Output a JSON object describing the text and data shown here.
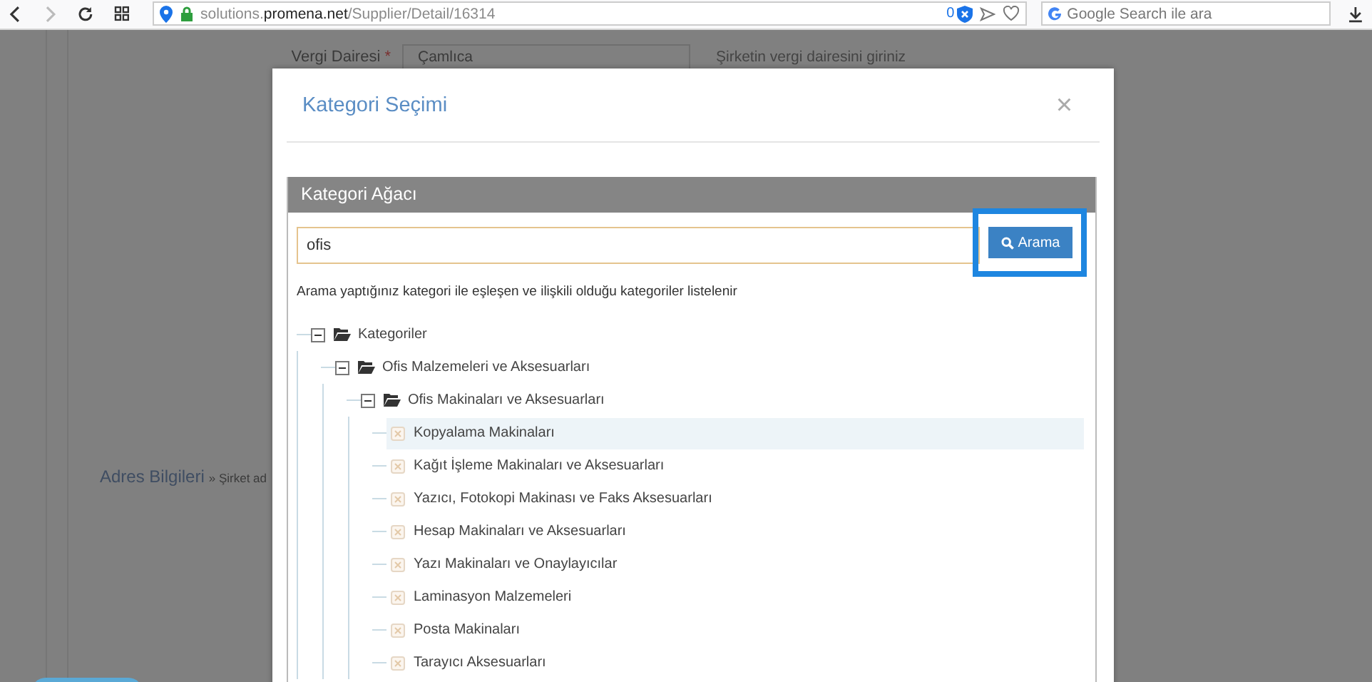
{
  "browser": {
    "url": "solutions.**promena.net**/Supplier/Detail/16314",
    "badge_count": "0",
    "search": {
      "placeholder": "Google Search ile ara"
    }
  },
  "background": {
    "tax_office": {
      "label": "Vergi Dairesi",
      "required_mark": "*",
      "value": "Çamlıca",
      "help": "Şirketin vergi dairesini giriniz"
    },
    "section": {
      "title": "Adres Bilgileri",
      "subtitle": "» Şirket ad"
    }
  },
  "modal": {
    "title": "Kategori Seçimi",
    "close": "×",
    "panel": {
      "title": "Kategori Ağacı",
      "search_value": "ofis",
      "search_button": "Arama",
      "hint": "Arama yaptığınız kategori ile eşleşen ve ilişkili olduğu kategoriler listelenir",
      "tree": [
        {
          "label": "Kategoriler",
          "expanded": true,
          "children": [
            {
              "label": "Ofis Malzemeleri ve Aksesuarları",
              "expanded": true,
              "children": [
                {
                  "label": "Ofis Makinaları ve Aksesuarları",
                  "expanded": true,
                  "children": [
                    {
                      "label": "Kopyalama Makinaları",
                      "selected": true
                    },
                    {
                      "label": "Kağıt İşleme Makinaları ve Aksesuarları",
                      "selected": false
                    },
                    {
                      "label": "Yazıcı, Fotokopi Makinası ve Faks Aksesuarları",
                      "selected": false
                    },
                    {
                      "label": "Hesap Makinaları ve Aksesuarları",
                      "selected": false
                    },
                    {
                      "label": "Yazı Makinaları ve Onaylayıcılar",
                      "selected": false
                    },
                    {
                      "label": "Laminasyon Malzemeleri",
                      "selected": false
                    },
                    {
                      "label": "Posta Makinaları",
                      "selected": false
                    },
                    {
                      "label": "Tarayıcı Aksesuarları",
                      "selected": false
                    }
                  ]
                }
              ]
            }
          ]
        }
      ]
    }
  }
}
